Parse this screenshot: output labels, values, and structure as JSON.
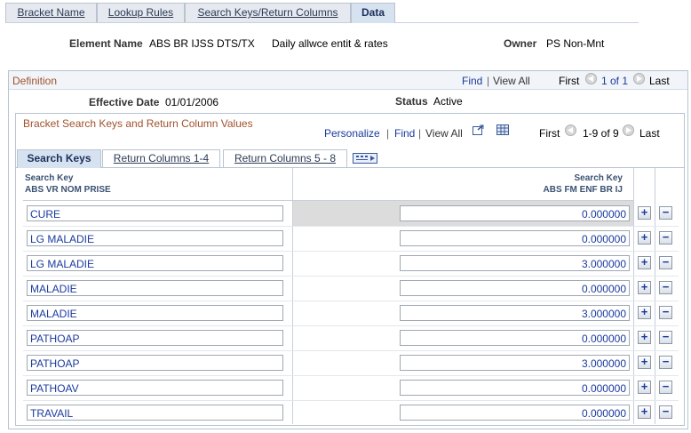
{
  "tabs": [
    "Bracket Name",
    "Lookup Rules",
    "Search Keys/Return Columns",
    "Data"
  ],
  "header": {
    "element_name_label": "Element Name",
    "element_name_value": "ABS BR IJSS DTS/TX",
    "element_desc": "Daily allwce entit & rates",
    "owner_label": "Owner",
    "owner_value": "PS Non-Mnt"
  },
  "definition": {
    "title": "Definition",
    "find": "Find",
    "view_all": "View All",
    "first": "First",
    "pager": "1 of 1",
    "last": "Last",
    "effective_date_label": "Effective Date",
    "effective_date_value": "01/01/2006",
    "status_label": "Status",
    "status_value": "Active"
  },
  "grid": {
    "title": "Bracket Search Keys and Return Column Values",
    "personalize": "Personalize",
    "find": "Find",
    "view_all": "View All",
    "first": "First",
    "pager": "1-9 of 9",
    "last": "Last",
    "tabs": [
      "Search Keys",
      "Return Columns 1-4",
      "Return Columns 5 - 8"
    ],
    "col1_header_line1": "Search Key",
    "col1_header_line2": "ABS VR NOM PRISE",
    "col2_header_line1": "Search Key",
    "col2_header_line2": "ABS FM ENF BR IJ",
    "rows": [
      {
        "key": "CURE",
        "value": "0.000000"
      },
      {
        "key": "LG MALADIE",
        "value": "0.000000"
      },
      {
        "key": "LG MALADIE",
        "value": "3.000000"
      },
      {
        "key": "MALADIE",
        "value": "0.000000"
      },
      {
        "key": "MALADIE",
        "value": "3.000000"
      },
      {
        "key": "PATHOAP",
        "value": "0.000000"
      },
      {
        "key": "PATHOAP",
        "value": "3.000000"
      },
      {
        "key": "PATHOAV",
        "value": "0.000000"
      },
      {
        "key": "TRAVAIL",
        "value": "0.000000"
      }
    ],
    "add_symbol": "+",
    "remove_symbol": "−"
  }
}
